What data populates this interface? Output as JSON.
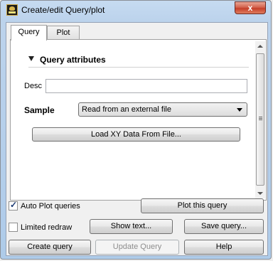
{
  "window": {
    "title": "Create/edit Query/plot",
    "close_glyph": "x"
  },
  "tabs": [
    {
      "label": "Query",
      "active": true
    },
    {
      "label": "Plot",
      "active": false
    }
  ],
  "query_panel": {
    "section_title": "Query attributes",
    "desc_label": "Desc",
    "desc_value": "",
    "sample_label": "Sample",
    "sample_selected": "Read from an external file",
    "load_button": "Load XY Data From File..."
  },
  "bottom": {
    "auto_plot_label": "Auto Plot queries",
    "auto_plot_checked": true,
    "limited_redraw_label": "Limited redraw",
    "limited_redraw_checked": false,
    "plot_this_query": "Plot this query",
    "show_text": "Show text...",
    "save_query": "Save query...",
    "create_query": "Create query",
    "update_query": "Update Query",
    "help": "Help"
  },
  "icons": {
    "app": "app-icon",
    "close": "close-icon",
    "collapse": "triangle-down-icon",
    "dropdown": "chevron-down-icon",
    "check": "checkmark-icon"
  }
}
